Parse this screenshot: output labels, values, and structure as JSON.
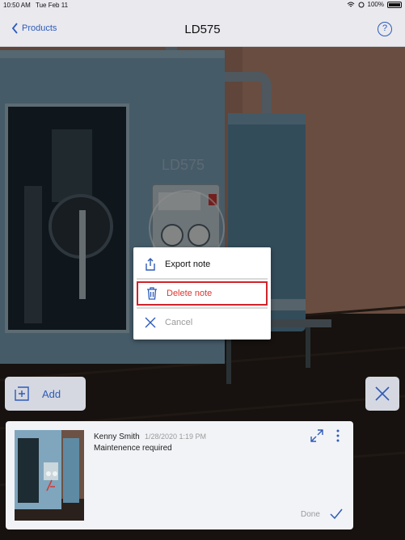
{
  "status_bar": {
    "time": "10:50 AM",
    "date": "Tue Feb 11",
    "battery": "100%"
  },
  "nav": {
    "back_label": "Products",
    "title": "LD575",
    "help_label": "?"
  },
  "scene": {
    "machine_label": "LD575"
  },
  "menu": {
    "items": [
      {
        "label": "Export note",
        "icon": "share-icon"
      },
      {
        "label": "Delete note",
        "icon": "trash-icon"
      },
      {
        "label": "Cancel",
        "icon": "close-icon"
      }
    ]
  },
  "actions": {
    "add_label": "Add"
  },
  "note": {
    "author": "Kenny Smith",
    "timestamp": "1/28/2020 1:19 PM",
    "text": "Maintenence required",
    "done_label": "Done"
  },
  "colors": {
    "accent": "#2e5bb8",
    "danger": "#e0362f",
    "nav_bg": "#e9e9ee"
  }
}
